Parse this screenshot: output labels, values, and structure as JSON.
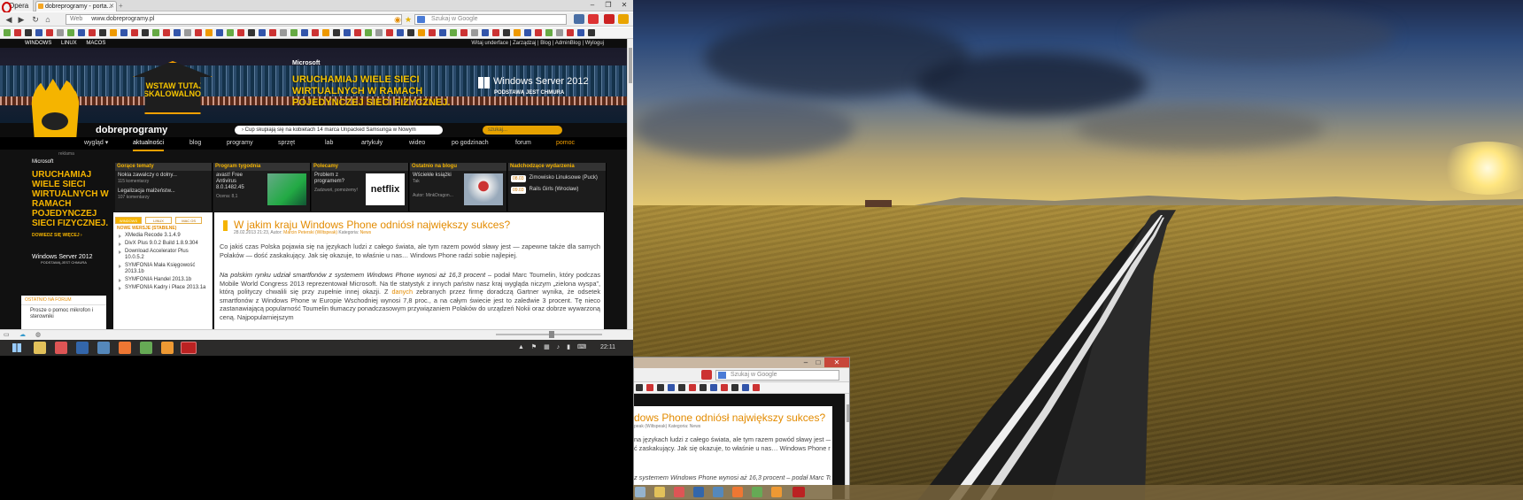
{
  "browser": {
    "menu_label": "Opera",
    "tab_title": "dobreprogramy - porta...",
    "url_prefix": "Web",
    "url": "www.dobreprogramy.pl",
    "search_placeholder": "Szukaj w Google"
  },
  "site": {
    "platforms": [
      "WINDOWS",
      "LINUX",
      "MACOS"
    ],
    "user_bar": "Witaj underface | Zarządzaj | Blog | AdminBlog | Wyloguj",
    "banner": {
      "brand": "Microsoft",
      "headline": "URUCHAMIAJ WIELE SIECI WIRTUALNYCH W RAMACH POJEDYNCZEJ SIECI FIZYCZNEJ.",
      "product": "Windows Server 2012",
      "product_sub": "PODSTAWĄ JEST CHMURA",
      "cta": "WSTAW TUTAJ SKALOWALNOŚĆ"
    },
    "logo": "dobreprogramy",
    "ticker": "› Cup skupiają się na kobietach    14 marca Unpacked Samsunga w Nowym",
    "search_placeholder": "szukaj...",
    "menu": [
      "wygląd ▾",
      "aktualności",
      "blog",
      "programy",
      "sprzęt",
      "lab",
      "artykuły",
      "wideo",
      "po godzinach",
      "forum",
      "pomoc"
    ],
    "ad": {
      "tag": "reklama",
      "brand": "Microsoft",
      "headline": "URUCHAMIAJ WIELE SIECI WIRTUALNYCH W RAMACH POJEDYNCZEJ SIECI FIZYCZNEJ.",
      "more": "DOWIEDZ SIĘ WIĘCEJ ›",
      "product": "Windows Server 2012",
      "product_sub": "PODSTAWĄ JEST CHMURA"
    },
    "forum": {
      "header": "OSTATNIO NA FORUM",
      "item": "Prosze o pomoc mikrofon i sterowniki"
    },
    "boxes": [
      {
        "title": "Gorące tematy",
        "line1": "Nokia zawalczy o dolny...",
        "line1_sub": "115 komentarzy",
        "line2": "Legalizacja małżeństw...",
        "line2_sub": "107 komentarzy"
      },
      {
        "title": "Program tygodnia",
        "line1": "avast! Free Antivirus 8.0.1482.45",
        "line2": "Ocena: 8,1"
      },
      {
        "title": "Polecamy",
        "line1": "Problem z programem?",
        "line2": "Zadzwoń, pomożemy!",
        "image_text": "netflix"
      },
      {
        "title": "Ostatnio na blogu",
        "line1": "Wściekłe książki",
        "line1_sub": "Tak",
        "line2": "Autor: MinkDragon..."
      },
      {
        "title": "Nadchodzące wydarzenia",
        "date1": "08.03",
        "event1": "Zimowisko Linuksowe (Puck)",
        "date2": "09.03",
        "event2": "Rails Girls (Wrocław)"
      }
    ],
    "os_tabs": [
      "WINDOWS",
      "LINUX",
      "MAC OS"
    ],
    "new_versions_header": "NOWE WERSJE (STABILNE)",
    "new_versions": [
      "XMedia Recode 3.1.4.9",
      "DivX Plus 9.0.2 Build 1.8.9.304",
      "Download Accelerator Plus 10.0.5.2",
      "SYMFONIA Mała Księgowość 2013.1b",
      "SYMFONIA Handel 2013.1b",
      "SYMFONIA Kadry i Płace 2013.1a"
    ],
    "article": {
      "title": "W jakim kraju Windows Phone odniósł największy sukces?",
      "meta_date": "28.02.2013 21:23, Autor: ",
      "meta_author": "Marcin Peterski (Wiltspeak)",
      "meta_cat": " Kategoria: ",
      "meta_cat_val": "News",
      "para1": "Co jakiś czas Polska pojawia się na językach ludzi z całego świata, ale tym razem powód sławy jest — zapewne także dla samych Polaków — dość zaskakujący. Jak się okazuje, to właśnie u nas… Windows Phone radzi sobie najlepiej.",
      "para2_em": "Na polskim rynku udział smartfonów z systemem Windows Phone wynosi aż 16,3 procent",
      "para2_a": " – podał Marc Toumelin, który podczas Mobile World Congress 2013 reprezentował Microsoft. Na tle statystyk z innych państw nasz kraj wygląda niczym „zielona wyspa”, którą polityczy chwalili się przy zupełnie innej okazji. Z ",
      "para2_link": "danych",
      "para2_b": " zebranych przez firmę doradczą Gartner wynika, że odsetek smartfonów z Windows Phone w Europie Wschodniej wynosi 7,8 proc., a na całym świecie jest to zaledwie 3 procent. Tę nieco zastanawiającą popularność Toumelin tłumaczy ponadczasowym przywiązaniem Polaków do urządzeń Nokii oraz dobrze wywarzoną ceną. Najpopularniejszym"
    }
  },
  "taskbar": {
    "clock": "22:11"
  },
  "window2": {
    "search_placeholder": "Szukaj w Google",
    "title": "dows Phone odniósł największy sukces?",
    "meta": "peak (Wiltspeak) Kategoria: News",
    "p1": "na językach ludzi z całego świata, ale tym razem powód sławy jest — zapewne",
    "p2": "ć zaskakujący. Jak się okazuje, to właśnie u nas… Windows Phone radzi sobie",
    "p3": "z systemem Windows Phone wynosi aż 16,3 procent – podał Marc Toumelin,"
  },
  "colors": {
    "accent": "#f5a000",
    "title_orange": "#e38b00"
  }
}
